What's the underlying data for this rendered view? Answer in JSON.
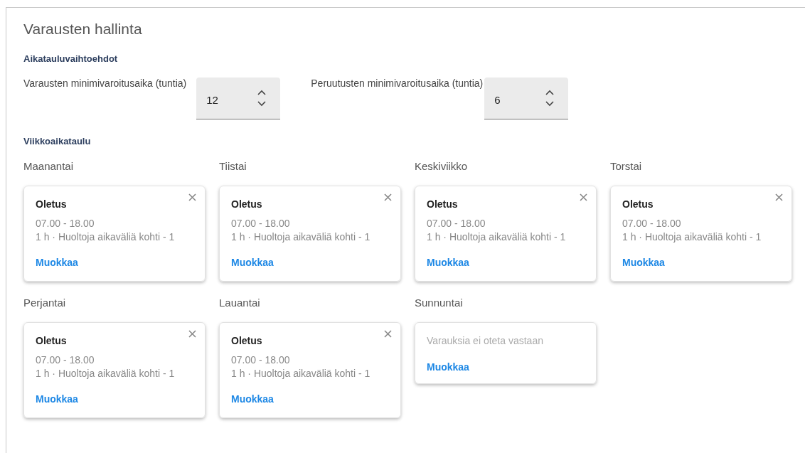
{
  "title": "Varausten hallinta",
  "options": {
    "heading": "Aikatauluvaihtoehdot",
    "fields": [
      {
        "label": "Varausten minimivaroitusaika (tuntia)",
        "value": "12"
      },
      {
        "label": "Peruutusten minimivaroitusaika (tuntia)",
        "value": "6"
      }
    ]
  },
  "schedule": {
    "heading": "Viikkoaikataulu",
    "days": [
      {
        "day": "Maanantai",
        "kind": "slot",
        "name": "Oletus",
        "hours": "07.00 - 18.00",
        "details": "1 h · Huoltoja aikaväliä kohti - 1",
        "action": "Muokkaa"
      },
      {
        "day": "Tiistai",
        "kind": "slot",
        "name": "Oletus",
        "hours": "07.00 - 18.00",
        "details": "1 h · Huoltoja aikaväliä kohti - 1",
        "action": "Muokkaa"
      },
      {
        "day": "Keskiviikko",
        "kind": "slot",
        "name": "Oletus",
        "hours": "07.00 - 18.00",
        "details": "1 h · Huoltoja aikaväliä kohti - 1",
        "action": "Muokkaa"
      },
      {
        "day": "Torstai",
        "kind": "slot",
        "name": "Oletus",
        "hours": "07.00 - 18.00",
        "details": "1 h · Huoltoja aikaväliä kohti - 1",
        "action": "Muokkaa"
      },
      {
        "day": "Perjantai",
        "kind": "slot",
        "name": "Oletus",
        "hours": "07.00 - 18.00",
        "details": "1 h · Huoltoja aikaväliä kohti - 1",
        "action": "Muokkaa"
      },
      {
        "day": "Lauantai",
        "kind": "slot",
        "name": "Oletus",
        "hours": "07.00 - 18.00",
        "details": "1 h · Huoltoja aikaväliä kohti - 1",
        "action": "Muokkaa"
      },
      {
        "day": "Sunnuntai",
        "kind": "closed",
        "message": "Varauksia ei oteta vastaan",
        "action": "Muokkaa"
      }
    ]
  }
}
